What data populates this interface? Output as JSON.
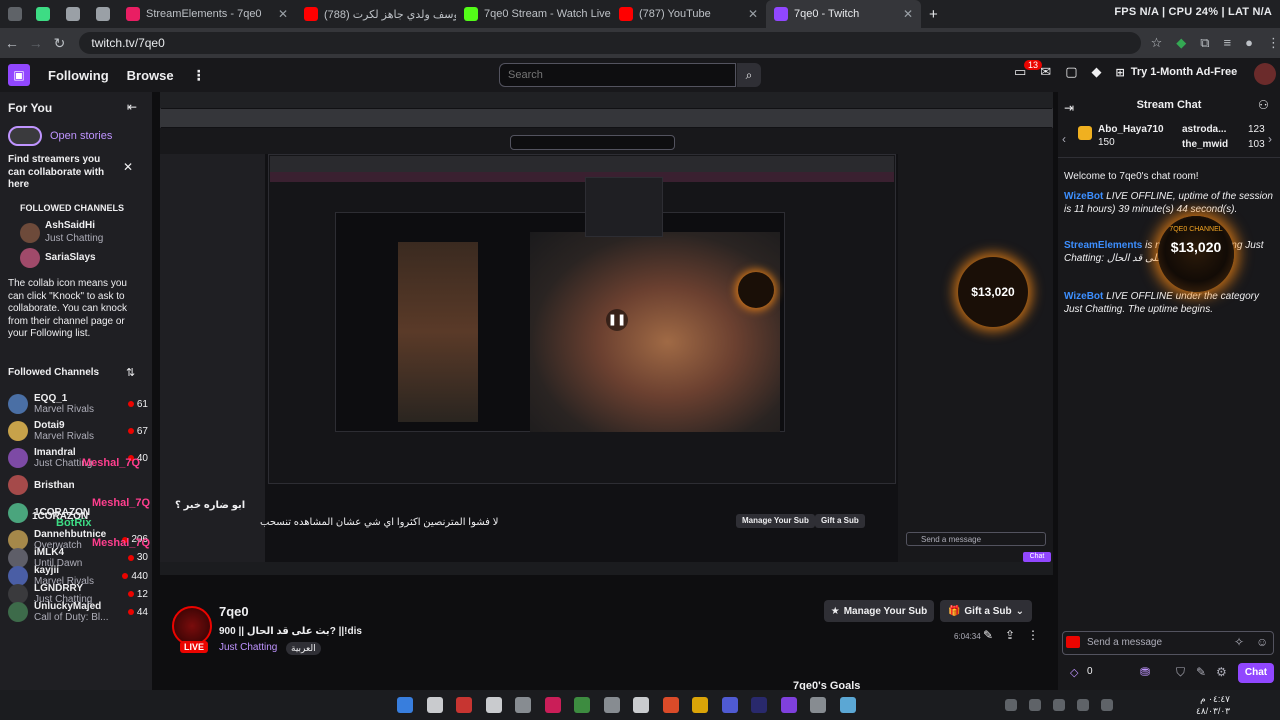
{
  "browser": {
    "tabs": [
      {
        "label": "",
        "color": "#5f6368"
      },
      {
        "label": "",
        "color": "#3ddc84"
      },
      {
        "label": "",
        "color": "#bdc1c6"
      },
      {
        "label": "",
        "color": "#bdc1c6"
      },
      {
        "label": "StreamElements - 7qe0",
        "color": "#e91e63"
      },
      {
        "label": "(788) هل يوسف ولدي جاهز لكرت",
        "color": "#ff0000"
      },
      {
        "label": "7qe0 Stream - Watch Live on Ki",
        "color": "#53fc18"
      },
      {
        "label": "(787) YouTube",
        "color": "#ff0000"
      },
      {
        "label": "7qe0 - Twitch",
        "color": "#9147ff"
      }
    ],
    "stats": "FPS N/A | CPU 24% | LAT N/A",
    "url": "twitch.tv/7qe0"
  },
  "topnav": {
    "following": "Following",
    "browse": "Browse",
    "search_placeholder": "Search",
    "notif_count": "13",
    "ad_free": "Try 1-Month Ad-Free"
  },
  "sidebar": {
    "for_you": "For You",
    "open_stories": "Open stories",
    "collab_title": "Find streamers you can collaborate with here",
    "followed_header": "FOLLOWED CHANNELS",
    "collab_channels": [
      {
        "name": "AshSaidHi",
        "cat": "Just Chatting"
      },
      {
        "name": "SariaSlays",
        "cat": ""
      }
    ],
    "collab_body": "The collab icon means you can click \"Knock\" to ask to collaborate. You can knock from their channel page or your Following list.",
    "followed_title": "Followed Channels",
    "channels": [
      {
        "name": "EQQ_1",
        "cat": "Marvel Rivals",
        "viewers": "61",
        "color": "#4a6fa5"
      },
      {
        "name": "Dotai9",
        "cat": "Marvel Rivals",
        "viewers": "67",
        "color": "#c7a24a"
      },
      {
        "name": "Imandral",
        "cat": "Just Chatting",
        "viewers": "40",
        "color": "#7d4aa5"
      },
      {
        "name": "Bristhan",
        "cat": "",
        "viewers": "",
        "color": "#a54a4a"
      },
      {
        "name": "1CORAZON",
        "cat": "",
        "viewers": "",
        "color": "#4aa57d"
      },
      {
        "name": "Dannehbutnice",
        "cat": "Overwatch",
        "viewers": "206",
        "color": "#a5884a"
      },
      {
        "name": "iMLK4",
        "cat": "Until Dawn",
        "viewers": "30",
        "color": "#5e5e68"
      },
      {
        "name": "kayjii",
        "cat": "Marvel Rivals",
        "viewers": "440",
        "color": "#4a5ea5"
      },
      {
        "name": "LGNDRRY",
        "cat": "Just Chatting",
        "viewers": "12",
        "color": "#3a3a3d"
      },
      {
        "name": "UnluckyMajed",
        "cat": "Call of Duty: Bl...",
        "viewers": "44",
        "color": "#3d6b4a"
      }
    ]
  },
  "chat": {
    "title": "Stream Chat",
    "leaders": [
      {
        "name": "Abo_Haya710",
        "amount": "150"
      },
      {
        "name": "astroda...",
        "amount": "123"
      },
      {
        "name": "the_mwid",
        "amount": "103"
      }
    ],
    "welcome": "Welcome to 7qe0's chat room!",
    "messages": [
      {
        "user": "WizeBot",
        "text": "LIVE OFFLINE, uptime of the session is 11 hours) 39 minute(s) 44 second(s)."
      },
      {
        "user": "StreamElements",
        "text": "is now live! Streaming Just Chatting: بث على قد الحال ||"
      },
      {
        "user": "WizeBot",
        "text": "LIVE OFFLINE under the category Just Chatting. The uptime begins."
      }
    ],
    "goal_amount": "$13,020",
    "goal_label": "7QE0 CHANNEL",
    "send_placeholder": "Send a message",
    "points": "0",
    "chat_button": "Chat"
  },
  "stream": {
    "name": "7qe0",
    "title": "بث على قد الحال || 900? ||!dis",
    "category": "Just Chatting",
    "tag": "العربية",
    "live": "LIVE",
    "uptime": "6:04:34",
    "manage_sub": "Manage Your Sub",
    "gift_sub": "Gift a Sub",
    "goals": "7qe0's Goals"
  },
  "clock": {
    "time": "٠٤:٤٧ م",
    "date": "٤٨/٠٣/٠٣"
  },
  "overlay": {
    "user1": "Meshal_7Q",
    "user2": "BotRix",
    "pinned": "1CORAZON",
    "arabic1": "لا فشوا المترنصين اكثروا اي شي عشان المشاهده تنسحب",
    "arabic2": "ابو ضاره خبر ؟"
  }
}
